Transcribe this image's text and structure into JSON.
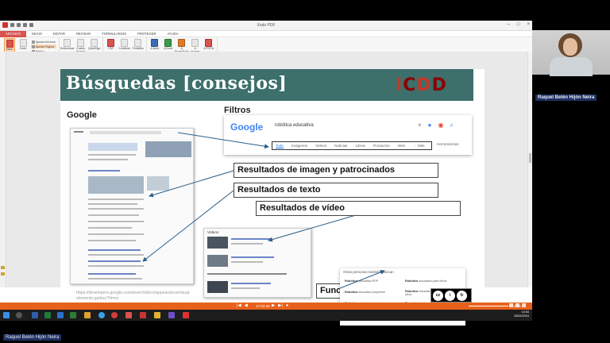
{
  "window": {
    "title": "Xodo PDF",
    "controls": [
      "–",
      "□",
      "×"
    ]
  },
  "menu": [
    "ARCHIVO",
    "INICIO",
    "EDITAR",
    "REVISAR",
    "FORMULARIOS",
    "PROTEGER",
    "AYUDA"
  ],
  "ribbon": {
    "view": {
      "mano": "Mano",
      "zoom": "Zoom",
      "ajustar_anchura": "Ajustar Anchura",
      "ajustar_pagina": "Ajustar Página",
      "pagina_x": "Reflujo",
      "label": "Ver"
    },
    "tools": {
      "seleccionar": "Seleccionar",
      "cuadro_texto": "Cuadro de texto",
      "quicksign": "QuickSign",
      "label": "Herramientas"
    },
    "create": {
      "pdf": "PDF",
      "combinar": "Combinar",
      "portafolio": "Portafolio",
      "label": "Crear"
    },
    "convert": {
      "word": "A Word",
      "excel": "A Excel",
      "powerpoint": "A PowerPoint",
      "jpeg": "A Imagen",
      "mas": "A PDF/A",
      "label": "Convertir"
    }
  },
  "document_tab": "Taller 4",
  "slide": {
    "title": "Búsquedas [consejos]",
    "logo": [
      "I",
      "C",
      "D",
      "D"
    ],
    "google_label": "Google",
    "filtros_label": "Filtros",
    "search": {
      "logo": "Google",
      "query": "robótica educativa",
      "tabs": [
        "Todo",
        "Imágenes",
        "Videos",
        "Noticias",
        "Libros",
        "Productos",
        "Web",
        "⋮ Más"
      ],
      "tools": "Herramientas"
    },
    "callouts": {
      "imagen": "Resultados de imagen y patrocinados",
      "texto": "Resultados de texto",
      "video": "Resultados de vídeo",
      "exploracion": "Funciones de exploración"
    },
    "related": {
      "header": "Otras personas también buscan",
      "items": [
        [
          "Robótica",
          "educativa PDF"
        ],
        [
          "Robótica",
          "educativa para niños"
        ],
        [
          "Robótica",
          "educativa proyectos"
        ],
        [
          "Robótica",
          "educativa para niños de 7 a 11 años"
        ],
        [
          "Robótica",
          "educativa ejemplos"
        ],
        [
          "Tipos de",
          "robótica educativa"
        ],
        [
          "Robótica",
          "educativa autor"
        ],
        [
          "Robótica",
          "educativa en educación infantil"
        ]
      ]
    },
    "videos_label": "Vídeos",
    "url": "https://developers.google.com/search/docs/appearance/visual-elements-gallery?hl=es"
  },
  "player": {
    "time": "17:03:49",
    "zoom": "114%"
  },
  "clock": {
    "time": "14:54",
    "date": "15/02/2024"
  },
  "camera": {
    "name": "Raquel Belén Hijón Neira"
  },
  "bottom_name": "Raquel Belén Hijón Neira",
  "colors": {
    "banner": "#3d6f6b",
    "accent": "#d9534f",
    "player": "#e8611c",
    "taskbar": "#1d1d1d"
  }
}
